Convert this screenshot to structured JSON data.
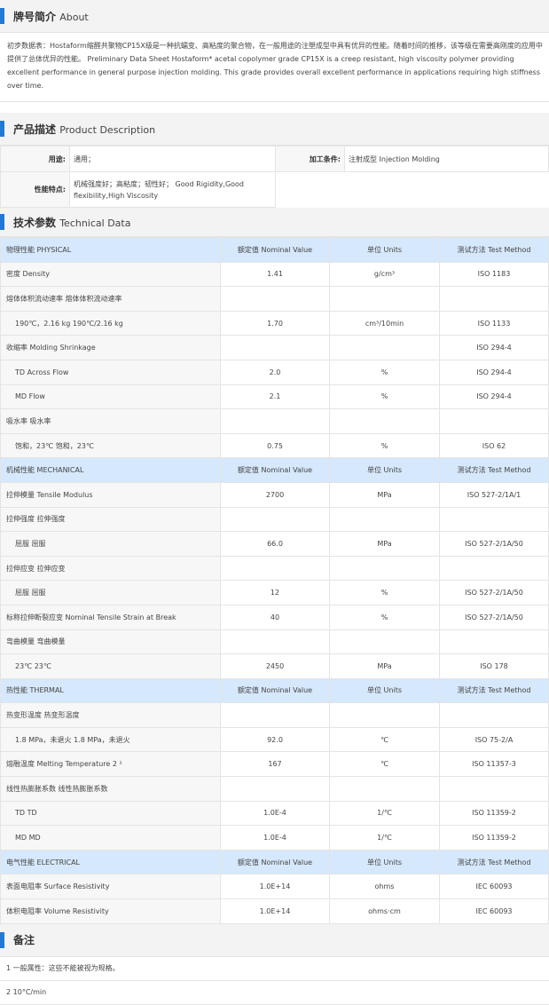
{
  "about": {
    "title_cn": "牌号简介",
    "title_en": "About",
    "text": "初步数据表：Hostaform缩醛共聚物CP15X级是一种抗蠕变、高粘度的聚合物，在一般用途的注塑成型中具有优异的性能。随着时间的推移，该等级在需要高刚度的应用中提供了总体优异的性能。 Preliminary Data Sheet Hostaform* acetal copolymer grade CP15X is a creep resistant, high viscosity polymer providing excellent performance in general purpose injection molding. This grade provides overall excellent performance in applications requiring high stiffness over time."
  },
  "product": {
    "title_cn": "产品描述",
    "title_en": "Product Description",
    "use_label": "用途:",
    "use_value": "通用；",
    "process_label": "加工条件:",
    "process_value": "注射成型  Injection Molding",
    "feature_label": "性能特点:",
    "feature_value": "机械强度好；高粘度；韧性好； Good Rigidity,Good flexibility,High Viscosity"
  },
  "technical": {
    "title_cn": "技术参数",
    "title_en": "Technical Data",
    "sections": [
      {
        "header": [
          "物理性能  PHYSICAL",
          "额定值  Nominal Value",
          "单位  Units",
          "测试方法  Test Method"
        ],
        "rows": [
          {
            "name": "密度  Density",
            "value": "1.41",
            "unit": "g/cm³",
            "method": "ISO 1183",
            "link": false,
            "sub": false
          },
          {
            "name": "熔体体积流动速率  熔体体积流动速率",
            "value": "",
            "unit": "",
            "method": "",
            "link": false,
            "sub": false
          },
          {
            "name": "190℃，2.16 kg  190℃/2.16 kg",
            "value": "1.70",
            "unit": "cm³/10min",
            "method": "ISO 1133",
            "link": true,
            "sub": true
          },
          {
            "name": "收缩率  Molding Shrinkage",
            "value": "",
            "unit": "",
            "method": "ISO 294-4",
            "link": false,
            "sub": false
          },
          {
            "name": "TD  Across Flow",
            "value": "2.0",
            "unit": "%",
            "method": "ISO 294-4",
            "link": false,
            "sub": true
          },
          {
            "name": "MD  Flow",
            "value": "2.1",
            "unit": "%",
            "method": "ISO 294-4",
            "link": false,
            "sub": true
          },
          {
            "name": "吸水率  吸水率",
            "value": "",
            "unit": "",
            "method": "",
            "link": false,
            "sub": false
          },
          {
            "name": "饱和，23℃  饱和，23℃",
            "value": "0.75",
            "unit": "%",
            "method": "ISO 62",
            "link": true,
            "sub": true
          }
        ]
      },
      {
        "header": [
          "机械性能  MECHANICAL",
          "额定值  Nominal Value",
          "单位  Units",
          "测试方法  Test Method"
        ],
        "rows": [
          {
            "name": "拉伸模量  Tensile Modulus",
            "value": "2700",
            "unit": "MPa",
            "method": "ISO 527-2/1A/1",
            "link": false,
            "sub": false
          },
          {
            "name": "拉伸强度  拉伸强度",
            "value": "",
            "unit": "",
            "method": "",
            "link": false,
            "sub": false
          },
          {
            "name": "屈服  屈服",
            "value": "66.0",
            "unit": "MPa",
            "method": "ISO 527-2/1A/50",
            "link": false,
            "sub": true
          },
          {
            "name": "拉伸应变  拉伸应变",
            "value": "",
            "unit": "",
            "method": "",
            "link": false,
            "sub": false
          },
          {
            "name": "屈服  屈服",
            "value": "12",
            "unit": "%",
            "method": "ISO 527-2/1A/50",
            "link": false,
            "sub": true
          },
          {
            "name": "标称拉伸断裂应变  Nominal Tensile Strain at Break",
            "value": "40",
            "unit": "%",
            "method": "ISO 527-2/1A/50",
            "link": false,
            "sub": false
          },
          {
            "name": "弯曲模量  弯曲模量",
            "value": "",
            "unit": "",
            "method": "",
            "link": false,
            "sub": false
          },
          {
            "name": "23℃  23℃",
            "value": "2450",
            "unit": "MPa",
            "method": "ISO 178",
            "link": false,
            "sub": true
          }
        ]
      },
      {
        "header": [
          "热性能  THERMAL",
          "额定值  Nominal Value",
          "单位  Units",
          "测试方法  Test Method"
        ],
        "rows": [
          {
            "name": "热变形温度  热变形温度",
            "value": "",
            "unit": "",
            "method": "",
            "link": false,
            "sub": false
          },
          {
            "name": "1.8 MPa，未退火  1.8 MPa，未退火",
            "value": "92.0",
            "unit": "℃",
            "method": "ISO 75-2/A",
            "link": false,
            "sub": true
          },
          {
            "name": "熔融温度  Melting Temperature  2 ²",
            "value": "167",
            "unit": "℃",
            "method": "ISO 11357-3",
            "link": true,
            "sub": false
          },
          {
            "name": "线性热膨胀系数  线性热膨胀系数",
            "value": "",
            "unit": "",
            "method": "",
            "link": false,
            "sub": false
          },
          {
            "name": "TD  TD",
            "value": "1.0E-4",
            "unit": "1/℃",
            "method": "ISO 11359-2",
            "link": false,
            "sub": true
          },
          {
            "name": "MD  MD",
            "value": "1.0E-4",
            "unit": "1/℃",
            "method": "ISO 11359-2",
            "link": false,
            "sub": true
          }
        ]
      },
      {
        "header": [
          "电气性能  ELECTRICAL",
          "额定值  Nominal Value",
          "单位  Units",
          "测试方法  Test Method"
        ],
        "rows": [
          {
            "name": "表面电阻率  Surface Resistivity",
            "value": "1.0E+14",
            "unit": "ohms",
            "method": "IEC 60093",
            "link": false,
            "sub": false
          },
          {
            "name": "体积电阻率  Volume Resistivity",
            "value": "1.0E+14",
            "unit": "ohms·cm",
            "method": "IEC 60093",
            "link": false,
            "sub": false
          }
        ]
      }
    ]
  },
  "notes": {
    "title_cn": "备注",
    "items": [
      "1 一般属性：这些不能被视为规格。",
      "2 10°C/min"
    ]
  },
  "colors": {
    "accent": "#1f7ad8",
    "category_bg": "#d6e8fb",
    "link": "#2a7ad6"
  }
}
